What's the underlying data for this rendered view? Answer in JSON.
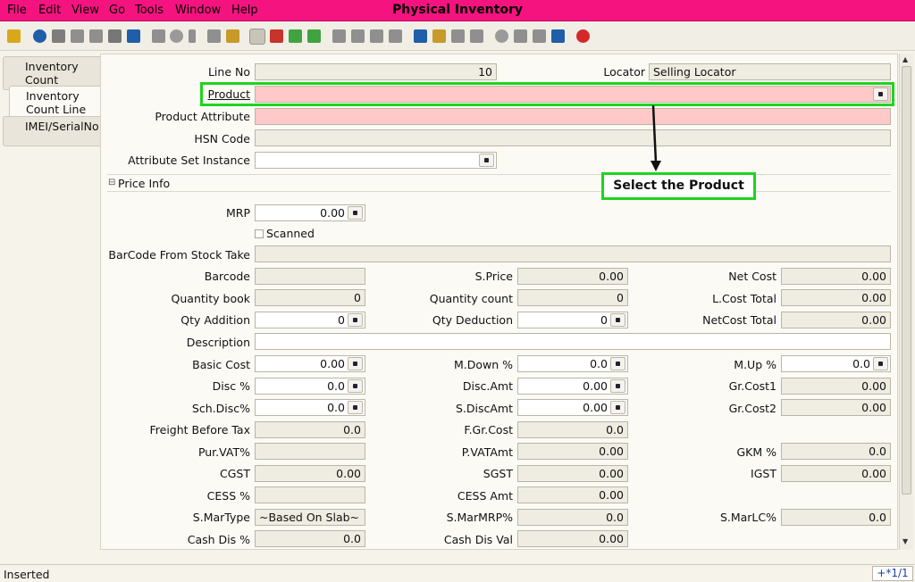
{
  "menubar": {
    "items": [
      "File",
      "Edit",
      "View",
      "Go",
      "Tools",
      "Window",
      "Help"
    ],
    "title": "Physical Inventory"
  },
  "toolbar": {
    "icons": [
      "undo-icon",
      "help-icon",
      "new-icon",
      "copy-icon",
      "delete-icon",
      "delete-selection-icon",
      "save-icon",
      "refresh-icon",
      "find-icon",
      "attachment-icon",
      "chat-icon",
      "history-icon",
      "grid-toggle-icon",
      "home-icon",
      "back-icon",
      "forward-icon",
      "first-record-icon",
      "previous-record-icon",
      "next-record-icon",
      "last-record-icon",
      "report-icon",
      "archive-icon",
      "print-icon",
      "print-preview-icon",
      "zoom-across-icon",
      "active-workflows-icon",
      "requests-icon",
      "product-info-icon",
      "exit-icon"
    ]
  },
  "tabs": [
    {
      "label": "Inventory Count"
    },
    {
      "label": "Inventory Count Line"
    },
    {
      "label": "IMEI/SerialNo"
    }
  ],
  "form": {
    "line_no_label": "Line No",
    "line_no": "10",
    "locator_label": "Locator",
    "locator": "Selling Locator",
    "product_label": "Product",
    "product": "",
    "product_attribute_label": "Product Attribute",
    "product_attribute": "",
    "hsn_code_label": "HSN Code",
    "hsn_code": "",
    "attribute_set_instance_label": "Attribute Set Instance",
    "attribute_set_instance": "",
    "price_info_label": "Price Info",
    "mrp_label": "MRP",
    "mrp": "0.00",
    "scanned_label": "Scanned",
    "barcode_from_stock_take_label": "BarCode From Stock Take",
    "barcode_from_stock_take": "",
    "barcode_label": "Barcode",
    "barcode": "",
    "s_price_label": "S.Price",
    "s_price": "0.00",
    "net_cost_label": "Net Cost",
    "net_cost": "0.00",
    "quantity_book_label": "Quantity book",
    "quantity_book": "0",
    "quantity_count_label": "Quantity count",
    "quantity_count": "0",
    "l_cost_total_label": "L.Cost Total",
    "l_cost_total": "0.00",
    "qty_addition_label": "Qty Addition",
    "qty_addition": "0",
    "qty_deduction_label": "Qty Deduction",
    "qty_deduction": "0",
    "netcost_total_label": "NetCost Total",
    "netcost_total": "0.00",
    "description_label": "Description",
    "description": "",
    "basic_cost_label": "Basic Cost",
    "basic_cost": "0.00",
    "m_down_label": "M.Down %",
    "m_down": "0.0",
    "m_up_label": "M.Up %",
    "m_up": "0.0",
    "disc_pct_label": "Disc %",
    "disc_pct": "0.0",
    "disc_amt_label": "Disc.Amt",
    "disc_amt": "0.00",
    "gr_cost1_label": "Gr.Cost1",
    "gr_cost1": "0.00",
    "sch_disc_label": "Sch.Disc%",
    "sch_disc": "0.0",
    "s_disc_amt_label": "S.DiscAmt",
    "s_disc_amt": "0.00",
    "gr_cost2_label": "Gr.Cost2",
    "gr_cost2": "0.00",
    "freight_before_tax_label": "Freight Before Tax",
    "freight_before_tax": "0.0",
    "f_gr_cost_label": "F.Gr.Cost",
    "f_gr_cost": "0.0",
    "pur_vat_label": "Pur.VAT%",
    "pur_vat": "",
    "p_vat_amt_label": "P.VATAmt",
    "p_vat_amt": "0.00",
    "gkm_label": "GKM %",
    "gkm": "0.0",
    "cgst_label": "CGST",
    "cgst": "0.00",
    "sgst_label": "SGST",
    "sgst": "0.00",
    "igst_label": "IGST",
    "igst": "0.00",
    "cess_pct_label": "CESS %",
    "cess_pct": "",
    "cess_amt_label": "CESS Amt",
    "cess_amt": "0.00",
    "s_martype_label": "S.MarType",
    "s_martype": "~Based On Slab~",
    "s_marmrp_label": "S.MarMRP%",
    "s_marmrp": "0.0",
    "s_marlc_label": "S.MarLC%",
    "s_marlc": "0.0",
    "cash_dis_pct_label": "Cash Dis %",
    "cash_dis_pct": "0.0",
    "cash_dis_val_label": "Cash Dis Val",
    "cash_dis_val": "0.00"
  },
  "annotation": {
    "callout": "Select the Product",
    "highlight_color": "#1ed41e"
  },
  "status": {
    "text": "Inserted",
    "record": "+*1/1"
  },
  "colors": {
    "menubar": "#f5137f",
    "mandatory_field": "#ffc9c9"
  }
}
